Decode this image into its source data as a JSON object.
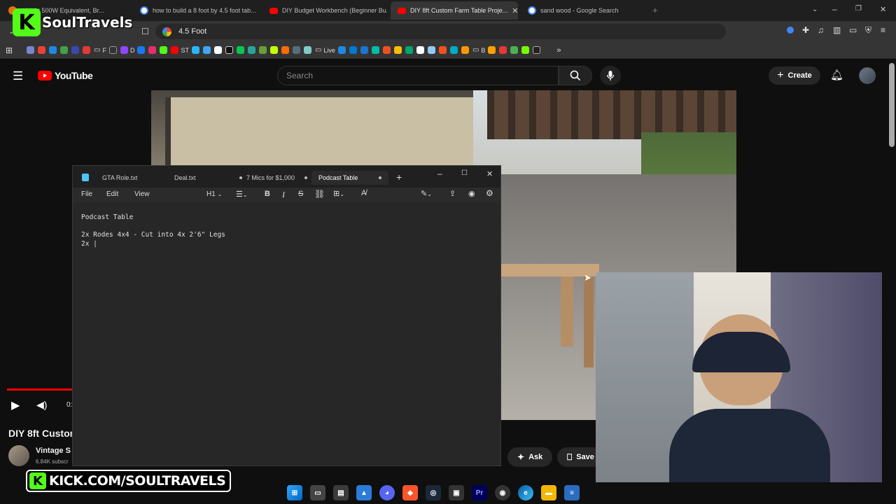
{
  "browser": {
    "tabs": [
      {
        "title": "d Light 500W Equivalent, Br...",
        "active": false
      },
      {
        "title": "how to build a 8 foot by 4.5 foot tab...",
        "active": false
      },
      {
        "title": "DIY Budget Workbench (Beginner Bu...",
        "active": false
      },
      {
        "title": "DIY 8ft Custom Farm Table Proje...",
        "active": true
      },
      {
        "title": "sand wood - Google Search",
        "active": false
      }
    ],
    "address": "4.5 Foot",
    "bookmarks": [
      "F",
      "D",
      "ST",
      "Live",
      "B"
    ]
  },
  "youtube": {
    "logo_text": "YouTube",
    "search_placeholder": "Search",
    "create_label": "Create",
    "video_title": "DIY 8ft Custom",
    "channel_name": "Vintage S",
    "subscribers": "6.84K subscr",
    "time_partial": "0:",
    "ask_label": "Ask",
    "save_label": "Save"
  },
  "notepad": {
    "tabs": [
      {
        "title": "GTA Role.txt",
        "modified": false
      },
      {
        "title": "Deal.txt",
        "modified": true
      },
      {
        "title": "7 Mics for $1,000",
        "modified": true
      },
      {
        "title": "Podcast Table",
        "modified": true
      }
    ],
    "menu": [
      "File",
      "Edit",
      "View"
    ],
    "heading_label": "H1",
    "content_lines": [
      "Podcast Table",
      "",
      "2x Rodes 4x4 - Cut into 4x 2'6\" Legs",
      "2x |"
    ]
  },
  "overlay": {
    "channel_logo_text": "SoulTravels",
    "kick_url": "KICK.COM/SOULTRAVELS"
  },
  "colors": {
    "kick_green": "#53fc18",
    "youtube_red": "#ff0000",
    "background": "#0f0f0f"
  }
}
